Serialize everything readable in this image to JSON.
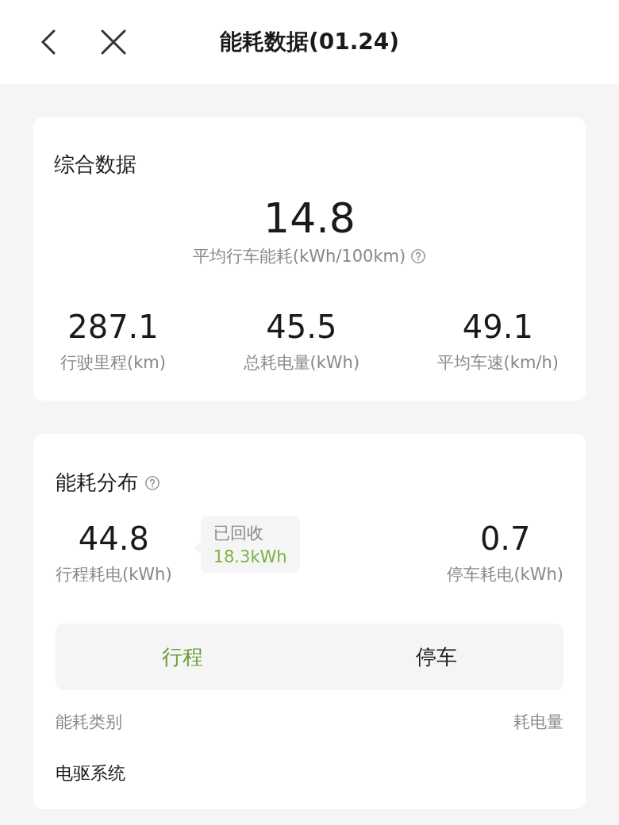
{
  "header": {
    "title": "能耗数据(01.24)"
  },
  "summary": {
    "title": "综合数据",
    "main_value": "14.8",
    "main_label": "平均行车能耗(kWh/100km)",
    "stats": [
      {
        "value": "287.1",
        "label": "行驶里程(km)"
      },
      {
        "value": "45.5",
        "label": "总耗电量(kWh)"
      },
      {
        "value": "49.1",
        "label": "平均车速(km/h)"
      }
    ]
  },
  "distribution": {
    "title": "能耗分布",
    "trip": {
      "value": "44.8",
      "label": "行程耗电(kWh)"
    },
    "recovered": {
      "label": "已回收",
      "value": "18.3kWh"
    },
    "parked": {
      "value": "0.7",
      "label": "停车耗电(kWh)"
    },
    "tabs": [
      {
        "label": "行程",
        "selected": true
      },
      {
        "label": "停车",
        "selected": false
      }
    ],
    "columns": [
      "能耗类别",
      "耗电量"
    ],
    "rows": [
      {
        "category": "电驱系统"
      }
    ]
  }
}
